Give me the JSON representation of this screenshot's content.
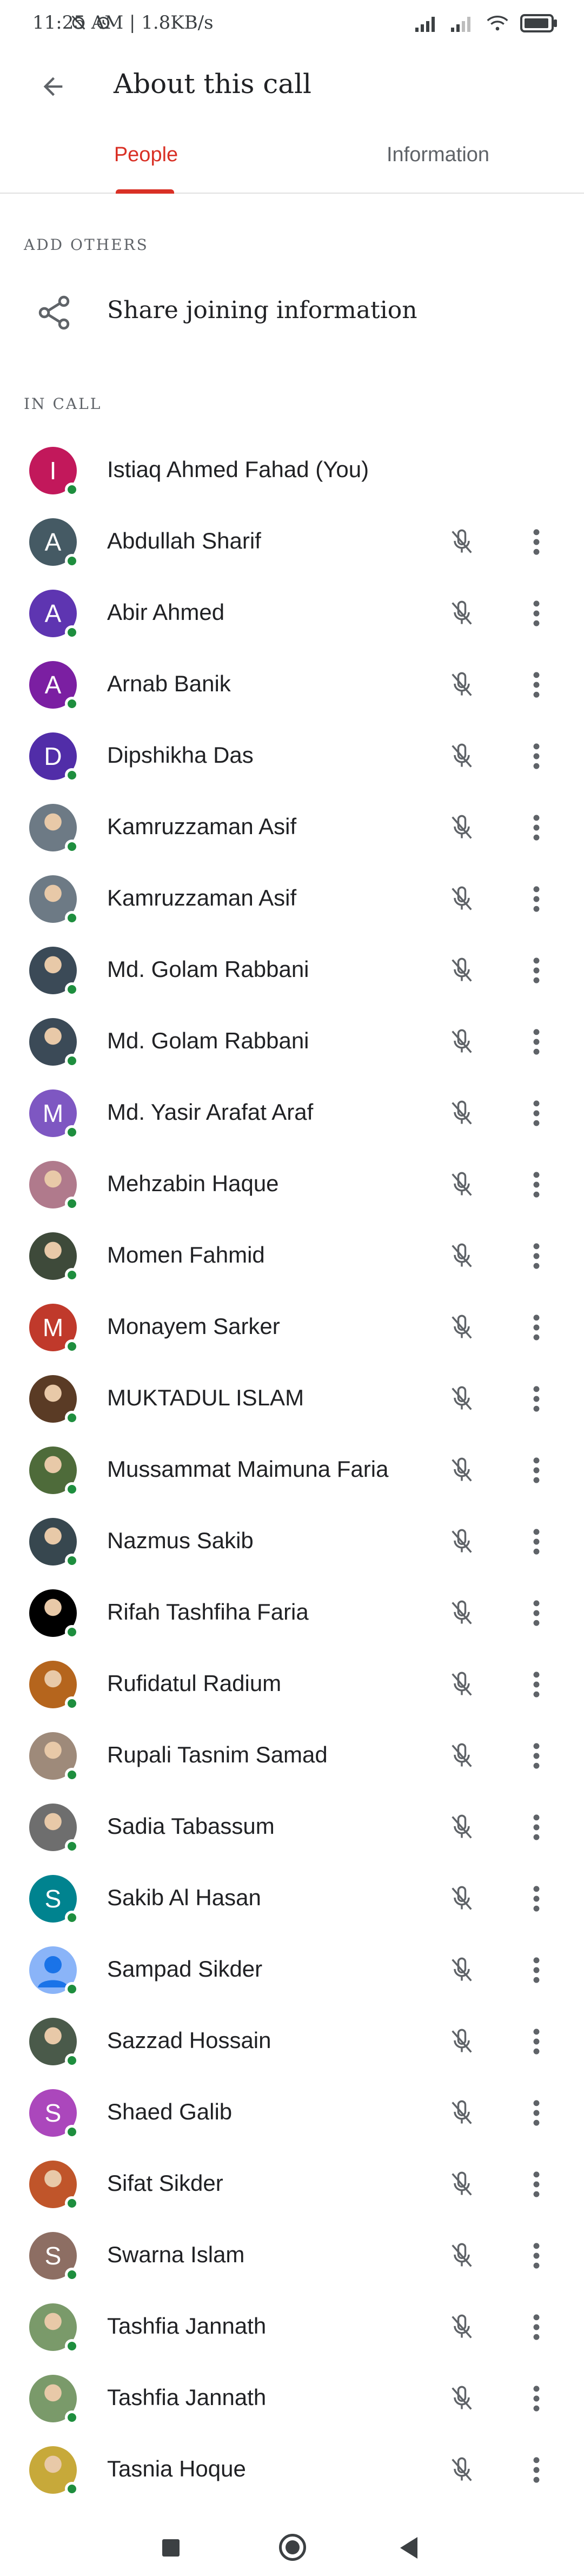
{
  "status_bar": {
    "time_text": "11:25 AM | 1.8KB/s",
    "icons": [
      "alarm-off-icon",
      "alarm-icon",
      "signal-icon",
      "signal-icon",
      "wifi-icon",
      "battery-icon"
    ]
  },
  "app_bar": {
    "title": "About this call",
    "back_icon": "arrow-back-icon"
  },
  "tabs": [
    {
      "label": "People",
      "active": true
    },
    {
      "label": "Information",
      "active": false
    }
  ],
  "add_others": {
    "section_label": "ADD OTHERS",
    "share_label": "Share joining information",
    "icon": "share-icon"
  },
  "in_call": {
    "section_label": "IN CALL",
    "participants": [
      {
        "name": "Istiaq Ahmed Fahad (You)",
        "letter": "I",
        "color": "#c2185b",
        "photo": false,
        "self": true
      },
      {
        "name": "Abdullah Sharif",
        "letter": "A",
        "color": "#455a64",
        "photo": false
      },
      {
        "name": "Abir Ahmed",
        "letter": "A",
        "color": "#5e35b1",
        "photo": false
      },
      {
        "name": "Arnab Banik",
        "letter": "A",
        "color": "#7b1fa2",
        "photo": false
      },
      {
        "name": "Dipshikha Das",
        "letter": "D",
        "color": "#512da8",
        "photo": false
      },
      {
        "name": "Kamruzzaman Asif",
        "letter": "",
        "color": "#6d7a85",
        "photo": true
      },
      {
        "name": "Kamruzzaman Asif",
        "letter": "",
        "color": "#6d7a85",
        "photo": true
      },
      {
        "name": "Md. Golam Rabbani",
        "letter": "",
        "color": "#3b4a57",
        "photo": true
      },
      {
        "name": "Md. Golam Rabbani",
        "letter": "",
        "color": "#3b4a57",
        "photo": true
      },
      {
        "name": "Md. Yasir Arafat Araf",
        "letter": "M",
        "color": "#7e57c2",
        "photo": false
      },
      {
        "name": "Mehzabin Haque",
        "letter": "",
        "color": "#b07a8c",
        "photo": true
      },
      {
        "name": "Momen Fahmid",
        "letter": "",
        "color": "#3e4a3a",
        "photo": true
      },
      {
        "name": "Monayem Sarker",
        "letter": "M",
        "color": "#c0392b",
        "photo": false
      },
      {
        "name": "MUKTADUL ISLAM",
        "letter": "",
        "color": "#5a3b25",
        "photo": true
      },
      {
        "name": "Mussammat Maimuna Faria",
        "letter": "",
        "color": "#4e6b3a",
        "photo": true
      },
      {
        "name": "Nazmus Sakib",
        "letter": "",
        "color": "#37474f",
        "photo": true
      },
      {
        "name": "Rifah Tashfiha Faria",
        "letter": "",
        "color": "#000000",
        "photo": true
      },
      {
        "name": "Rufidatul Radium",
        "letter": "",
        "color": "#b5651d",
        "photo": true
      },
      {
        "name": "Rupali Tasnim Samad",
        "letter": "",
        "color": "#9e8a7a",
        "photo": true
      },
      {
        "name": "Sadia Tabassum",
        "letter": "",
        "color": "#6e6e6e",
        "photo": true
      },
      {
        "name": "Sakib Al Hasan",
        "letter": "S",
        "color": "#00838f",
        "photo": false
      },
      {
        "name": "Sampad Sikder",
        "letter": "",
        "color": "#8ab4f8",
        "photo": true,
        "default_avatar": true
      },
      {
        "name": "Sazzad Hossain",
        "letter": "",
        "color": "#4a5a4a",
        "photo": true
      },
      {
        "name": "Shaed Galib",
        "letter": "S",
        "color": "#ab47bc",
        "photo": false
      },
      {
        "name": "Sifat Sikder",
        "letter": "",
        "color": "#c0552a",
        "photo": true
      },
      {
        "name": "Swarna Islam",
        "letter": "S",
        "color": "#8d6e63",
        "photo": false
      },
      {
        "name": "Tashfia Jannath",
        "letter": "",
        "color": "#7a9a6a",
        "photo": true
      },
      {
        "name": "Tashfia Jannath",
        "letter": "",
        "color": "#7a9a6a",
        "photo": true
      },
      {
        "name": "Tasnia Hoque",
        "letter": "",
        "color": "#c7a93a",
        "photo": true
      }
    ]
  },
  "nav_bar": {
    "buttons": [
      "recents-button",
      "home-button",
      "back-button"
    ]
  },
  "colors": {
    "accent": "#d93025",
    "online": "#1e8e3e",
    "icon": "#5f6368"
  }
}
